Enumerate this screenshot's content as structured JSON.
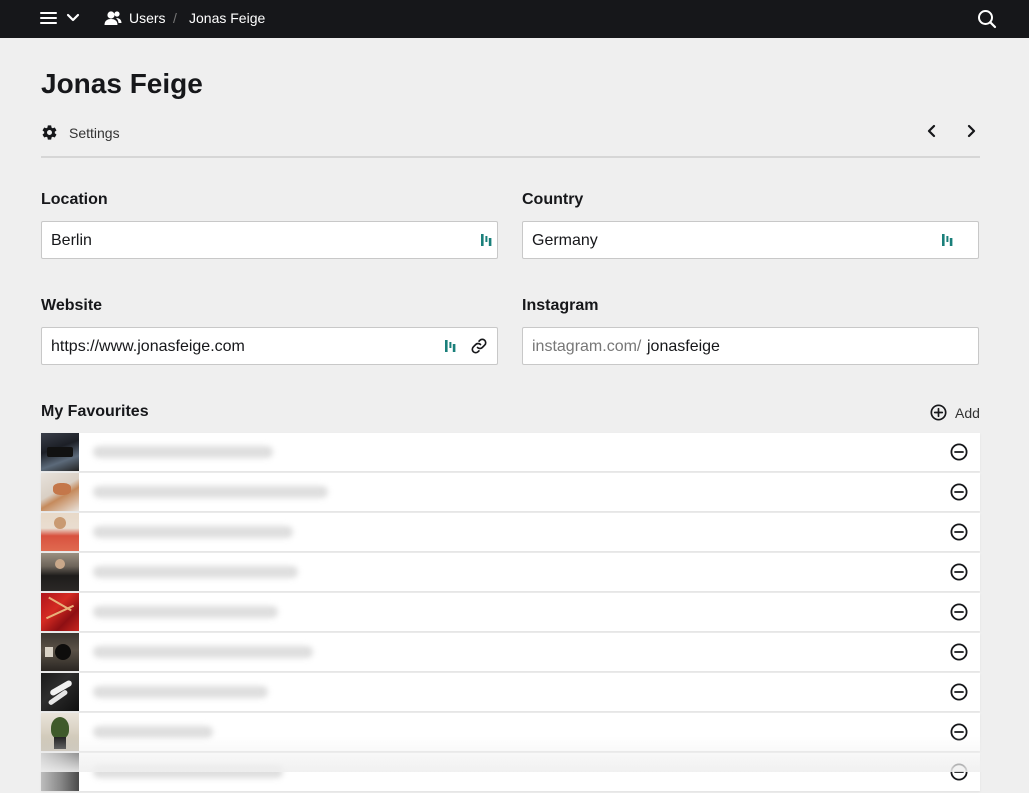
{
  "topbar": {
    "menu_icon": "hamburger-icon",
    "dropdown_icon": "chevron-down-icon",
    "users_icon": "users-icon",
    "breadcrumb": {
      "users_label": "Users",
      "separator": "/",
      "current_label": "Jonas Feige"
    },
    "search_icon": "search-icon"
  },
  "header": {
    "title": "Jonas Feige",
    "settings_label": "Settings",
    "settings_icon": "gear-icon",
    "prev_icon": "chevron-left-icon",
    "next_icon": "chevron-right-icon"
  },
  "fields": {
    "location": {
      "label": "Location",
      "value": "Berlin"
    },
    "country": {
      "label": "Country",
      "value": "Germany"
    },
    "website": {
      "label": "Website",
      "value": "https://www.jonasfeige.com"
    },
    "instagram": {
      "label": "Instagram",
      "prefix": "instagram.com/",
      "value": "jonasfeige"
    }
  },
  "favourites": {
    "heading": "My Favourites",
    "add_label": "Add",
    "add_icon": "add-circle-icon",
    "remove_icon": "remove-circle-icon",
    "item_count_visible": 9,
    "item_titles_blurred": true
  },
  "colors": {
    "topbar_bg": "#16171a",
    "page_bg": "#efefef",
    "accent_teal": "#1a7f7a"
  }
}
